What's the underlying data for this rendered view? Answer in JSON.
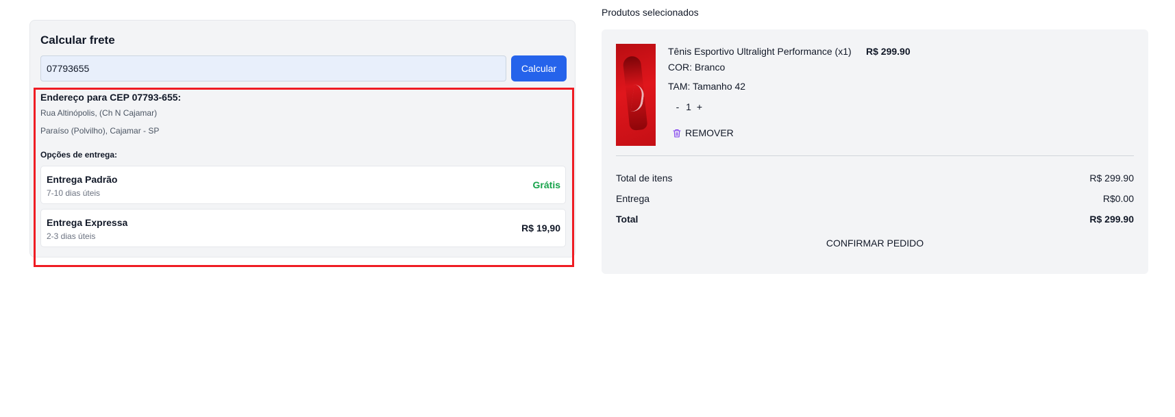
{
  "shipping": {
    "title": "Calcular frete",
    "cep_value": "07793655",
    "calc_button": "Calcular",
    "address_title": "Endereço para CEP 07793-655:",
    "address_line1": "Rua Altinópolis, (Ch N Cajamar)",
    "address_line2": "Paraíso (Polvilho), Cajamar - SP",
    "options_title": "Opções de entrega:",
    "options": [
      {
        "name": "Entrega Padrão",
        "eta": "7-10 dias úteis",
        "price": "Grátis"
      },
      {
        "name": "Entrega Expressa",
        "eta": "2-3 dias úteis",
        "price": "R$ 19,90"
      }
    ]
  },
  "summary": {
    "section_label": "Produtos selecionados",
    "product": {
      "name": "Tênis Esportivo Ultralight Performance (x1)",
      "price": "R$ 299.90",
      "color": "COR: Branco",
      "size": "TAM: Tamanho 42",
      "qty_minus": "-",
      "qty": "1",
      "qty_plus": "+",
      "remove_label": "REMOVER"
    },
    "rows": [
      {
        "label": "Total de itens",
        "value": "R$ 299.90"
      },
      {
        "label": "Entrega",
        "value": "R$0.00"
      },
      {
        "label": "Total",
        "value": "R$ 299.90"
      }
    ],
    "confirm_button": "CONFIRMAR PEDIDO"
  },
  "colors": {
    "primary": "#2563eb",
    "free_shipping": "#16a34a",
    "highlight": "#ef1c23",
    "trash_icon": "#7c3aed"
  },
  "icons": {
    "remove": "trash-icon"
  }
}
